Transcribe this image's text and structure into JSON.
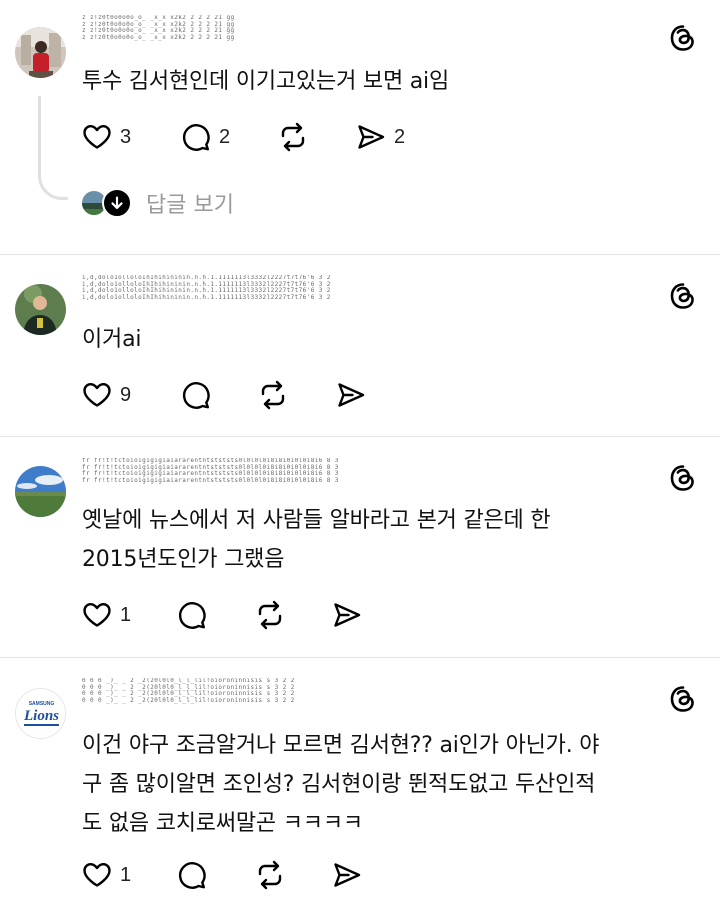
{
  "posts": [
    {
      "username": "z z!z0t0o0o0o_o_ _x_x x2k2 2 2 2 21 gg\nz z!z0t0o0o0o_o_ _x_x x2k2 2 2 2 21 gg\nz z!z0t0o0o0o_o_ _x_x x2k2 2 2 2 21 gg\nz z!z0t0o0o0o_o_ _x_x x2k2 2 2 2 21 gg",
      "text": "투수 김서현인데 이기고있는거 보면 ai임",
      "likes": "3",
      "replies": "2",
      "reposts": "",
      "shares": "2",
      "see_replies_label": "답글 보기"
    },
    {
      "username": "i,d,dolo1olloloIhIhihininin.n.h.1.1111113l3332l2227t7t76'6 3 2\ni,d,dolo1olloloIhIhihininin.n.h.1.1111113l3332l2227t7t76'6 3 2\ni,d,dolo1olloloIhIhihininin.n.h.1.1111113l3332l2227t7t76'6 3 2\ni,d,dolo1olloloIhIhihininin.n.h.1.1111113l3332l2227t7t76'6 3 2",
      "text": "이거ai",
      "likes": "9",
      "replies": "",
      "reposts": "",
      "shares": ""
    },
    {
      "username": "fr fr!t!tctoioigigigiaiararentntstststs0l0l0l0i8i8i0i0l0i8i6 8 3 2\nfr fr!t!tctoioigigigiaiararentntstststs0l0l0l0i8i8i0i0l0i8i6 8 3 2\nfr fr!t!tctoioigigigiaiararentntstststs0l0l0l0i8i8i0i0l0i8i6 8 3 2\nfr fr!t!tctoioigigigiaiararentntstststs0l0l0l0i8i8i0i0l0i8i6 8 3 2",
      "text_lines": [
        "옛날에 뉴스에서 저 사람들 알바라고 본거 같은데 한",
        "2015년도인가 그랬음"
      ],
      "likes": "1",
      "replies": "",
      "reposts": "",
      "shares": ""
    },
    {
      "username": "0 0 0 _)_ _ 2 _2(20l0l0_l_l_lil!oioroninnisis s 3 2 2\n0 0 0 _)_ _ 2 _2(20l0l0_l_l_lil!oioroninnisis s 3 2 2\n0 0 0 _)_ _ 2 _2(20l0l0_l_l_lil!oioroninnisis s 3 2 2\n0 0 0 _)_ _ 2 _2(20l0l0_l_l_lil!oioroninnisis s 3 2 2",
      "text_lines": [
        "이건 야구 조금알거나 모르면 김서현?? ai인가 아닌가. 야",
        "구 좀 많이알면 조인성? 김서현이랑 뛴적도없고 두산인적",
        "도 없음 코치로써말곤  ㅋㅋㅋㅋ"
      ],
      "likes": "1",
      "replies": "",
      "reposts": "",
      "shares": "",
      "avatar_text": "Lions",
      "avatar_subtext": "SAMSUNG"
    }
  ],
  "colors": {
    "divider": "#e3e3e3",
    "muted_text": "#9a9a9a",
    "lions_blue": "#1d4fa1"
  },
  "icons": [
    "heart-icon",
    "comment-icon",
    "repost-icon",
    "share-icon",
    "threads-logo-icon",
    "arrow-down-icon"
  ]
}
